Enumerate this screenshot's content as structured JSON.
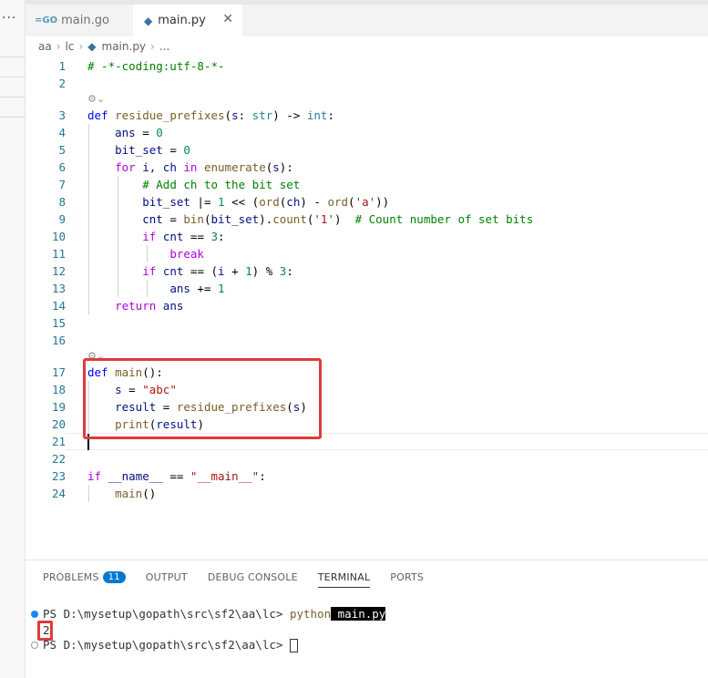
{
  "tabs": [
    {
      "label": "main.go",
      "icon": "go-file-icon",
      "active": false
    },
    {
      "label": "main.py",
      "icon": "python-file-icon",
      "active": true
    }
  ],
  "tab_close_glyph": "✕",
  "breadcrumb": {
    "parts": [
      "aa",
      "lc",
      "main.py",
      "..."
    ]
  },
  "code": {
    "codelens_glyph": "⚙⌄",
    "lines": [
      "1",
      "2",
      "3",
      "4",
      "5",
      "6",
      "7",
      "8",
      "9",
      "10",
      "11",
      "12",
      "13",
      "14",
      "15",
      "16",
      "17",
      "18",
      "19",
      "20",
      "21",
      "22",
      "23",
      "24"
    ],
    "l1": "# -*-coding:utf-8-*-",
    "l3_kw": "def",
    "l3_fn": "residue_prefixes",
    "l3_param": "s",
    "l3_type": "str",
    "l3_ret": "int",
    "l4_var": "ans",
    "l4_num": "0",
    "l5_var": "bit_set",
    "l5_num": "0",
    "l6_for": "for",
    "l6_vars": "i, ch",
    "l6_in": "in",
    "l6_fn": "enumerate",
    "l6_arg": "s",
    "l7": "# Add ch to the bit set",
    "l8_var": "bit_set",
    "l8_op": " |= ",
    "l8_num": "1",
    "l8_mid": " << (",
    "l8_fn1": "ord",
    "l8_ch": "ch",
    "l8_minus": ") - ",
    "l8_fn2": "ord",
    "l8_str": "'a'",
    "l9_var": "cnt",
    "l9_fn": "bin",
    "l9_arg": "bit_set",
    "l9_fn2": "count",
    "l9_str": "'1'",
    "l9_cmt": "# Count number of set bits",
    "l10_if": "if",
    "l10_var": "cnt",
    "l10_num": "3",
    "l11": "break",
    "l12_if": "if",
    "l12_var": "cnt",
    "l12_i": "i",
    "l12_num1": "1",
    "l12_num2": "3",
    "l13_var": "ans",
    "l13_num": "1",
    "l14_ret": "return",
    "l14_var": "ans",
    "l17_kw": "def",
    "l17_fn": "main",
    "l18_var": "s",
    "l18_str": "\"abc\"",
    "l19_var": "result",
    "l19_fn": "residue_prefixes",
    "l19_arg": "s",
    "l20_fn": "print",
    "l20_arg": "result",
    "l23_if": "if",
    "l23_var": "__name__",
    "l23_str": "\"__main__\"",
    "l24_fn": "main"
  },
  "panel": {
    "tabs": [
      "PROBLEMS",
      "OUTPUT",
      "DEBUG CONSOLE",
      "TERMINAL",
      "PORTS"
    ],
    "problems_count": "11",
    "active_tab": "TERMINAL"
  },
  "terminal": {
    "prompt1": "PS D:\\mysetup\\gopath\\src\\sf2\\aa\\lc> ",
    "cmd_word": "python",
    "cmd_arg": " main.py",
    "output": "2",
    "prompt2": "PS D:\\mysetup\\gopath\\src\\sf2\\aa\\lc> "
  },
  "colors": {
    "highlight_box": "#e03a3a",
    "keyword": "#0000ff",
    "control": "#af00db",
    "function": "#795e26",
    "comment": "#008000"
  }
}
